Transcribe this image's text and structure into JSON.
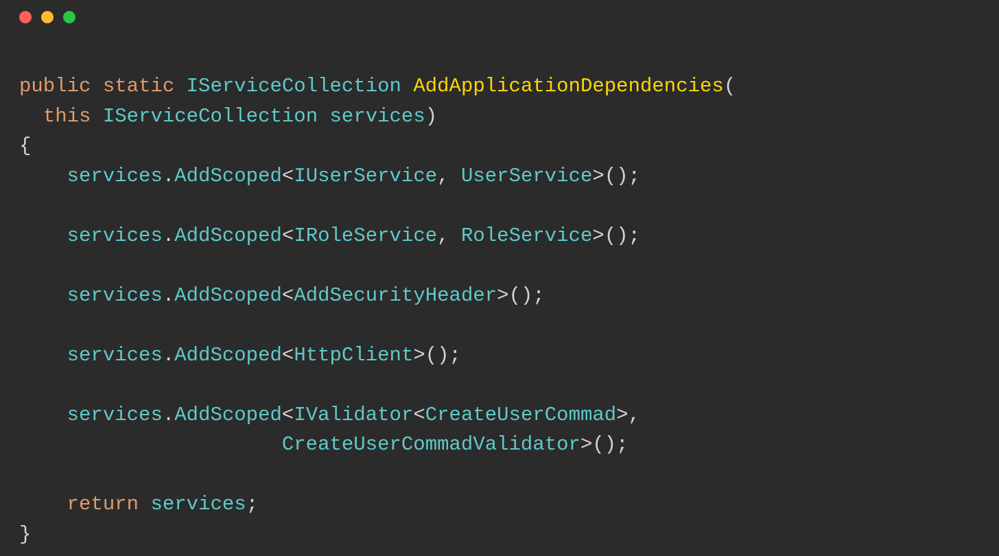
{
  "titlebar": {
    "buttons": [
      "close",
      "minimize",
      "maximize"
    ]
  },
  "code": {
    "l1_public": "public",
    "l1_static": "static",
    "l1_type": "IServiceCollection",
    "l1_method": "AddApplicationDependencies",
    "l1_paren": "(",
    "l2_indent": "  ",
    "l2_this": "this",
    "l2_type": "IServiceCollection",
    "l2_param": "services",
    "l2_paren": ")",
    "l3_brace": "{",
    "l4_indent": "    ",
    "l4_svc": "services",
    "l4_dot": ".",
    "l4_add": "AddScoped",
    "l4_lt": "<",
    "l4_t1": "IUserService",
    "l4_comma": ", ",
    "l4_t2": "UserService",
    "l4_gt": ">",
    "l4_end": "();",
    "l6_indent": "    ",
    "l6_svc": "services",
    "l6_dot": ".",
    "l6_add": "AddScoped",
    "l6_lt": "<",
    "l6_t1": "IRoleService",
    "l6_comma": ", ",
    "l6_t2": "RoleService",
    "l6_gt": ">",
    "l6_end": "();",
    "l8_indent": "    ",
    "l8_svc": "services",
    "l8_dot": ".",
    "l8_add": "AddScoped",
    "l8_lt": "<",
    "l8_t1": "AddSecurityHeader",
    "l8_gt": ">",
    "l8_end": "();",
    "l10_indent": "    ",
    "l10_svc": "services",
    "l10_dot": ".",
    "l10_add": "AddScoped",
    "l10_lt": "<",
    "l10_t1": "HttpClient",
    "l10_gt": ">",
    "l10_end": "();",
    "l12_indent": "    ",
    "l12_svc": "services",
    "l12_dot": ".",
    "l12_add": "AddScoped",
    "l12_lt": "<",
    "l12_t1": "IValidator",
    "l12_lt2": "<",
    "l12_t2": "CreateUserCommad",
    "l12_gt2": ">",
    "l12_comma": ",",
    "l13_indent": "                      ",
    "l13_t1": "CreateUserCommadValidator",
    "l13_gt": ">",
    "l13_end": "();",
    "l15_indent": "    ",
    "l15_return": "return",
    "l15_sp": " ",
    "l15_svc": "services",
    "l15_semi": ";",
    "l16_brace": "}"
  }
}
